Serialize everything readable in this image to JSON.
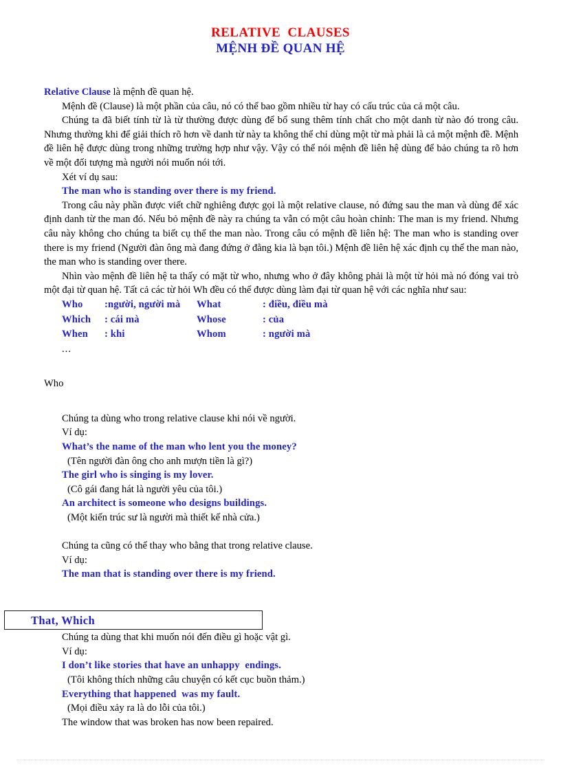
{
  "document": {
    "title_en": "RELATIVE  CLAUSES",
    "title_vi": "MỆNH ĐỀ QUAN HỆ",
    "colors": {
      "title_en": "#ff0000",
      "title_vi": "#2222cc",
      "accent_blue": "#2222cc",
      "body_text": "#000000"
    }
  },
  "intro": {
    "lead_term": "Relative Clause",
    "lead_rest": " là mệnh đề quan hệ.",
    "p_clause_def": "Mệnh đề (Clause) là một phần của câu, nó có thể bao gồm nhiều từ hay có cấu trúc của cả một câu.",
    "p_adjective": "Chúng ta đã biết tính từ là từ thường được dùng để bổ sung thêm tính chất cho một danh từ nào đó trong câu. Nhưng thường khi để giải thích rõ hơn về danh từ này ta không thể chỉ dùng một từ mà phải là cả một mệnh đề. Mệnh đề liên hệ được dùng trong những trường hợp như vậy.  Vậy có thể nói mệnh đề liên hệ dùng để bảo chúng ta rõ hơn về một đối tượng mà người nói muốn nói tới.",
    "p_xet_vi_du": "Xét ví dụ sau:",
    "example_man_who": "The man who is standing over there is my friend.",
    "p_explain": "Trong câu này phần được viết chữ nghiêng được gọi là một relative clause, nó đứng sau the man và dùng để xác định danh từ the man đó. Nếu bỏ mệnh đề này ra chúng ta vẫn có một câu hoàn chỉnh: The man is my friend. Nhưng câu này không cho chúng ta biết cụ thể the man nào. Trong câu có mệnh đề liên hệ: The man who is standing over there is my friend (Người đàn ông mà đang đứng ở đằng kia là bạn tôi.) Mệnh đề liên hệ xác định cụ thể the man nào, the man who is standing over there.",
    "p_wh_intro": "Nhìn vào mệnh đề liên hệ ta thấy có mặt từ who, nhưng who ở đây không phải là một từ hỏi mà nó đóng vai trò một đại từ quan hệ. Tất cả các từ hỏi Wh đều có thể được dùng làm đại từ quan hệ với các nghĩa như sau:"
  },
  "wh_table": {
    "rows": [
      {
        "c1": "Who",
        "c2": ":người, người mà",
        "c3": "What",
        "c4": ": điều, điều mà"
      },
      {
        "c1": "Which",
        "c2": ": cái mà",
        "c3": "Whose",
        "c4": ": của"
      },
      {
        "c1": "When",
        "c2": ": khi",
        "c3": "Whom",
        "c4": ": người mà"
      }
    ],
    "ellipsis": "..."
  },
  "section_who": {
    "heading": "Who",
    "p_usage": "Chúng ta dùng who trong relative clause khi nói về người.",
    "p_vi_du": "Ví dụ:",
    "examples": [
      {
        "en": "What’s the name of the man who lent you the money?",
        "vi": "(Tên người đàn ông cho anh mượn tiền là gì?)"
      },
      {
        "en": "The girl who is singing is my lover.",
        "vi": "(Cô gái đang hát là người yêu của tôi.)"
      },
      {
        "en": "An architect is someone who designs buildings.",
        "vi": "(Một kiến trúc sư là người mà thiết kế nhà cửa.)"
      }
    ],
    "p_that_swap": "Chúng ta cũng có thể thay who bằng that trong relative clause.",
    "p_vi_du2": "Ví dụ:",
    "example_that": "The man that is standing over there is my friend."
  },
  "section_that_which": {
    "box_label": "That, Which",
    "p_usage": "Chúng ta dùng that khi muốn nói đến điều gì hoặc vật gì.",
    "p_vi_du": "Ví dụ:",
    "examples": [
      {
        "en": "I don’t like stories that have an unhappy  endings.",
        "vi": "(Tôi không thích những câu chuyện có kết cục buồn thảm.)"
      },
      {
        "en": "Everything that happened  was my fault.",
        "vi": "(Mọi điều xảy ra là do lỗi của tôi.)"
      }
    ],
    "plain_example": "The window that was broken has now been repaired."
  }
}
